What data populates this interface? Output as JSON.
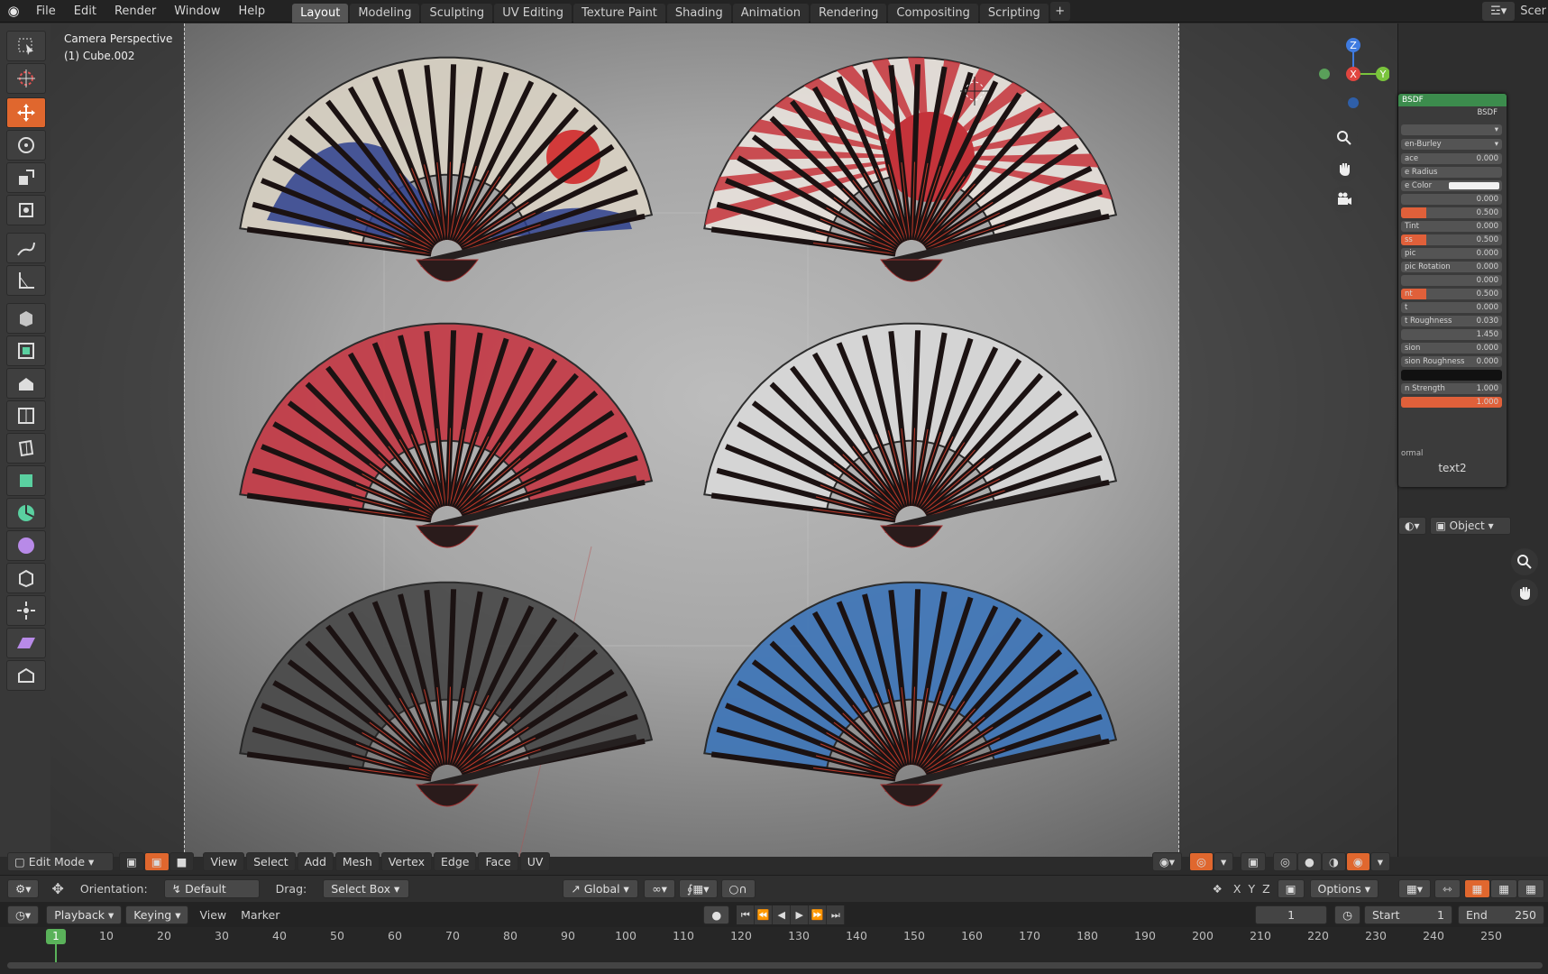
{
  "menu": [
    "File",
    "Edit",
    "Render",
    "Window",
    "Help"
  ],
  "workspaces": [
    "Layout",
    "Modeling",
    "Sculpting",
    "UV Editing",
    "Texture Paint",
    "Shading",
    "Animation",
    "Rendering",
    "Compositing",
    "Scripting"
  ],
  "active_workspace": "Layout",
  "scene_label": "Scer",
  "viewport": {
    "info_line1": "Camera Perspective",
    "info_line2": "(1) Cube.002"
  },
  "gizmo": {
    "z": "Z",
    "y": "Y",
    "x": "X"
  },
  "shader_node": {
    "title": "BSDF",
    "output": "BSDF",
    "dropdown": "en-Burley",
    "rows": [
      {
        "label": "ace",
        "value": "0.000"
      },
      {
        "label": "e Radius",
        "value": ""
      },
      {
        "label": "e Color",
        "value": ""
      },
      {
        "label": "",
        "value": "0.000"
      },
      {
        "label": "",
        "value": "0.500",
        "fill": 0.25
      },
      {
        "label": "Tint",
        "value": "0.000"
      },
      {
        "label": "ss",
        "value": "0.500",
        "fill": 0.25
      },
      {
        "label": "pic",
        "value": "0.000"
      },
      {
        "label": "pic Rotation",
        "value": "0.000"
      },
      {
        "label": "",
        "value": "0.000"
      },
      {
        "label": "nt",
        "value": "0.500",
        "fill": 0.25
      },
      {
        "label": "t",
        "value": "0.000"
      },
      {
        "label": "t Roughness",
        "value": "0.030"
      },
      {
        "label": "",
        "value": "1.450"
      },
      {
        "label": "sion",
        "value": "0.000"
      },
      {
        "label": "sion Roughness",
        "value": "0.000"
      },
      {
        "label": "",
        "value": ""
      },
      {
        "label": "n Strength",
        "value": "1.000"
      },
      {
        "label": "",
        "value": "1.000",
        "fill": 1.0
      }
    ],
    "normal_label": "ormal",
    "texture_label": "text2",
    "object_label": "Object"
  },
  "viewport_header": {
    "mode": "Edit Mode",
    "menus": [
      "View",
      "Select",
      "Add",
      "Mesh",
      "Vertex",
      "Edge",
      "Face",
      "UV"
    ]
  },
  "tool_settings": {
    "orientation_label": "Orientation:",
    "orientation_value": "Default",
    "drag_label": "Drag:",
    "drag_value": "Select Box",
    "transform_orientation": "Global",
    "axes": [
      "X",
      "Y",
      "Z"
    ],
    "options_label": "Options"
  },
  "timeline": {
    "playback": "Playback",
    "keying": "Keying",
    "view": "View",
    "marker": "Marker",
    "current_frame": "1",
    "start_label": "Start",
    "start_value": "1",
    "end_label": "End",
    "end_value": "250",
    "ticks": [
      "10",
      "20",
      "30",
      "40",
      "50",
      "60",
      "70",
      "80",
      "90",
      "100",
      "110",
      "120",
      "130",
      "140",
      "150",
      "160",
      "170",
      "180",
      "190",
      "200",
      "210",
      "220",
      "230",
      "240",
      "250"
    ],
    "playhead_frame": "1"
  },
  "fans": [
    {
      "name": "fan-wave",
      "paper": "#d9d2c4"
    },
    {
      "name": "fan-rising-sun",
      "paper": "#e7e1db"
    },
    {
      "name": "fan-red",
      "paper": "#c43b47"
    },
    {
      "name": "fan-white",
      "paper": "#d8d8d8"
    },
    {
      "name": "fan-dark",
      "paper": "#4a4a4a"
    },
    {
      "name": "fan-blue",
      "paper": "#3f76b8"
    }
  ]
}
